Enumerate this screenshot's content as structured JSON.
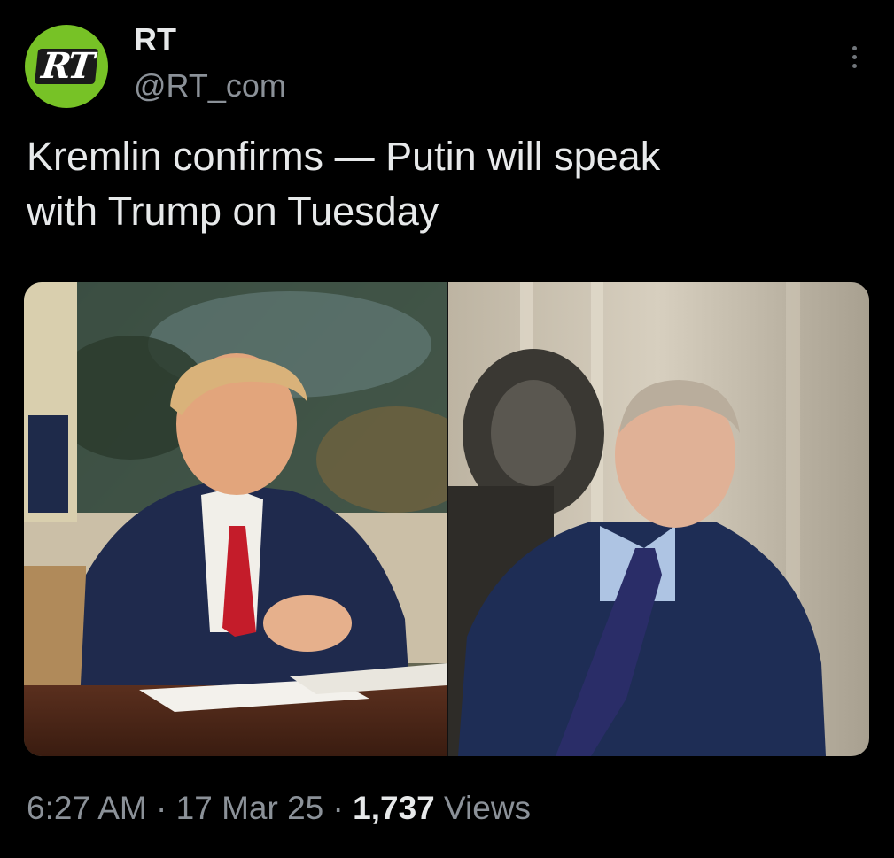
{
  "author": {
    "display_name": "RT",
    "handle": "@RT_com",
    "avatar_text": "RT",
    "avatar_color": "#77c226"
  },
  "menu": {
    "icon": "more-vertical-icon"
  },
  "tweet": {
    "text": "Kremlin confirms — Putin will speak\nwith Trump on Tuesday"
  },
  "media": {
    "left_photo": "trump-photo",
    "right_photo": "putin-photo"
  },
  "footer": {
    "time": "6:27 AM",
    "sep1": " · ",
    "date": "17 Mar 25",
    "sep2": " · ",
    "views_count": "1,737",
    "views_label": " Views"
  },
  "colors": {
    "background": "#000000",
    "text": "#e7e9ea",
    "secondary_text": "#8b9198"
  }
}
